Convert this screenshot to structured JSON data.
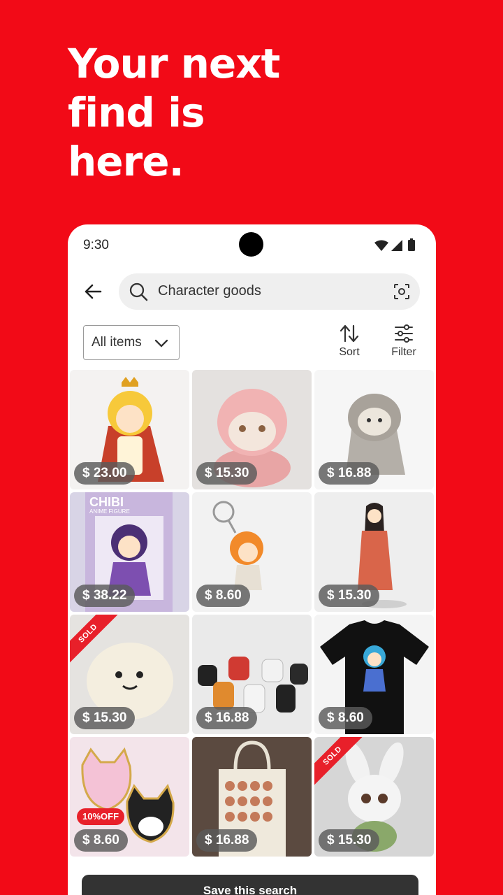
{
  "headline": {
    "line1": "Your next",
    "line2": "find is",
    "line3": "here."
  },
  "status": {
    "time": "9:30"
  },
  "search": {
    "query": "Character goods"
  },
  "filters": {
    "dropdown_label": "All items",
    "sort_label": "Sort",
    "filter_label": "Filter"
  },
  "items": [
    {
      "price": "$ 23.00"
    },
    {
      "price": "$ 15.30"
    },
    {
      "price": "$ 16.88"
    },
    {
      "price": "$ 38.22",
      "box_title": "CHIBI",
      "box_subtitle": "ANIME FIGURE"
    },
    {
      "price": "$ 8.60"
    },
    {
      "price": "$ 15.30"
    },
    {
      "price": "$ 15.30",
      "badge": "SOLD"
    },
    {
      "price": "$ 16.88"
    },
    {
      "price": "$ 8.60"
    },
    {
      "price": "$ 8.60",
      "discount": "10%OFF"
    },
    {
      "price": "$ 16.88"
    },
    {
      "price": "$ 15.30",
      "badge": "SOLD"
    }
  ],
  "save_button": "Save this search",
  "colors": {
    "brand": "#f20a17",
    "sold": "#e8202a"
  }
}
